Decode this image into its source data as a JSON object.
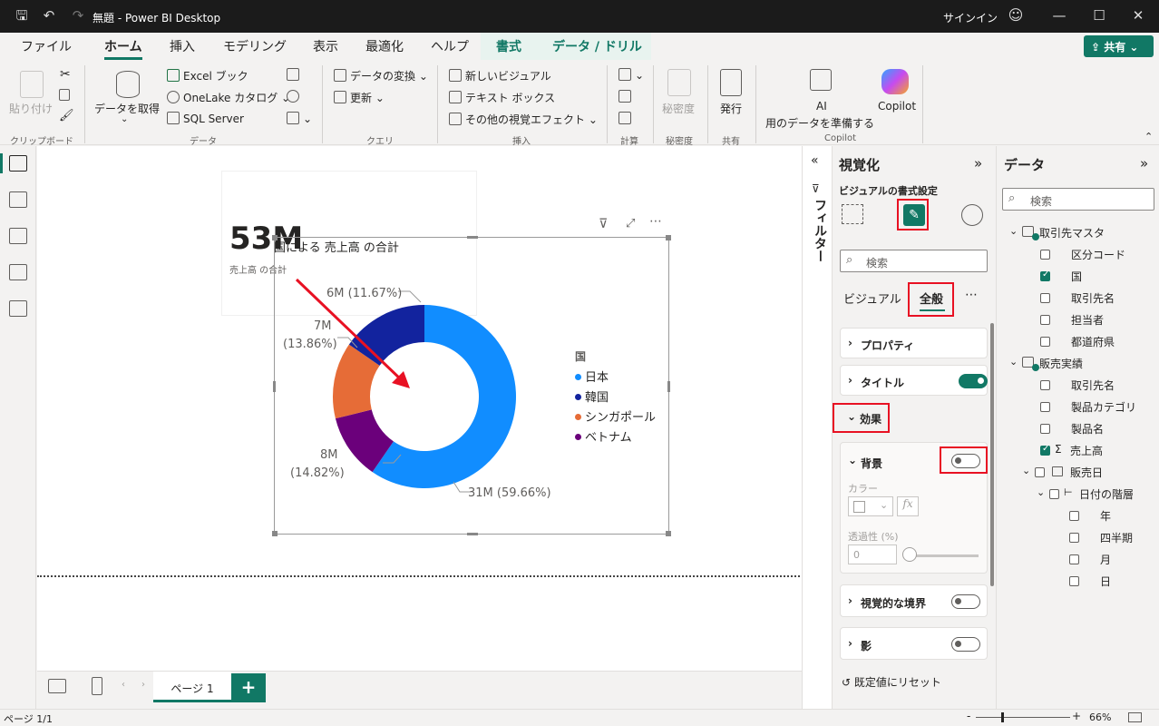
{
  "window": {
    "title": "無題 - Power BI Desktop",
    "signin": "サインイン",
    "share": "共有"
  },
  "menu": {
    "tabs": [
      "ファイル",
      "ホーム",
      "挿入",
      "モデリング",
      "表示",
      "最適化",
      "ヘルプ",
      "書式",
      "データ / ドリル"
    ]
  },
  "ribbon": {
    "paste": "貼り付け",
    "get_data": "データを取得",
    "excel": "Excel ブック",
    "onelake": "OneLake カタログ",
    "sql": "SQL Server",
    "transform": "データの変換",
    "refresh": "更新",
    "new_visual": "新しいビジュアル",
    "textbox": "テキスト ボックス",
    "more_visuals": "その他の視覚エフェクト",
    "sensitivity": "秘密度",
    "publish": "発行",
    "ai_line1": "AI",
    "ai_line2": "用のデータを準備する",
    "copilot": "Copilot",
    "groups": [
      "クリップボード",
      "データ",
      "クエリ",
      "挿入",
      "計算",
      "秘密度",
      "共有",
      "Copilot"
    ]
  },
  "card": {
    "value": "53M",
    "label": "売上高 の合計"
  },
  "visual": {
    "title": "国による 売上高 の合計"
  },
  "chart_data": {
    "type": "pie",
    "title": "国による 売上高 の合計",
    "categories": [
      "日本",
      "ベトナム",
      "シンガポール",
      "韓国"
    ],
    "values": [
      31,
      6,
      7,
      8
    ],
    "labels": [
      "31M (59.66%)",
      "6M (11.67%)",
      "7M",
      "8M"
    ],
    "percents": [
      "(13.86%)",
      "(14.82%)"
    ],
    "colors": [
      "#118dff",
      "#6b007b",
      "#e66c37",
      "#12239e"
    ],
    "legend_title": "国",
    "legend": [
      "日本",
      "韓国",
      "シンガポール",
      "ベトナム"
    ],
    "legend_colors": [
      "#118dff",
      "#12239e",
      "#e66c37",
      "#6b007b"
    ]
  },
  "filter": {
    "label": "フィルター"
  },
  "viz": {
    "title": "視覚化",
    "subtitle": "ビジュアルの書式設定",
    "search": "検索",
    "tab_visual": "ビジュアル",
    "tab_general": "全般",
    "props": "プロパティ",
    "title_sec": "タイトル",
    "effects": "効果",
    "background": "背景",
    "color": "カラー",
    "transparency": "透過性 (%)",
    "transparency_value": "0",
    "border": "視覚的な境界",
    "shadow": "影",
    "reset": "既定値にリセット"
  },
  "data": {
    "title": "データ",
    "search": "検索",
    "t1": "取引先マスタ",
    "t1_fields": [
      "区分コード",
      "国",
      "取引先名",
      "担当者",
      "都道府県"
    ],
    "t2": "販売実績",
    "t2_fields": [
      "取引先名",
      "製品カテゴリ",
      "製品名",
      "売上高",
      "販売日",
      "日付の階層",
      "年",
      "四半期",
      "月",
      "日"
    ]
  },
  "pages": {
    "page1": "ページ 1"
  },
  "status": {
    "page": "ページ 1/1",
    "zoom": "66%"
  }
}
